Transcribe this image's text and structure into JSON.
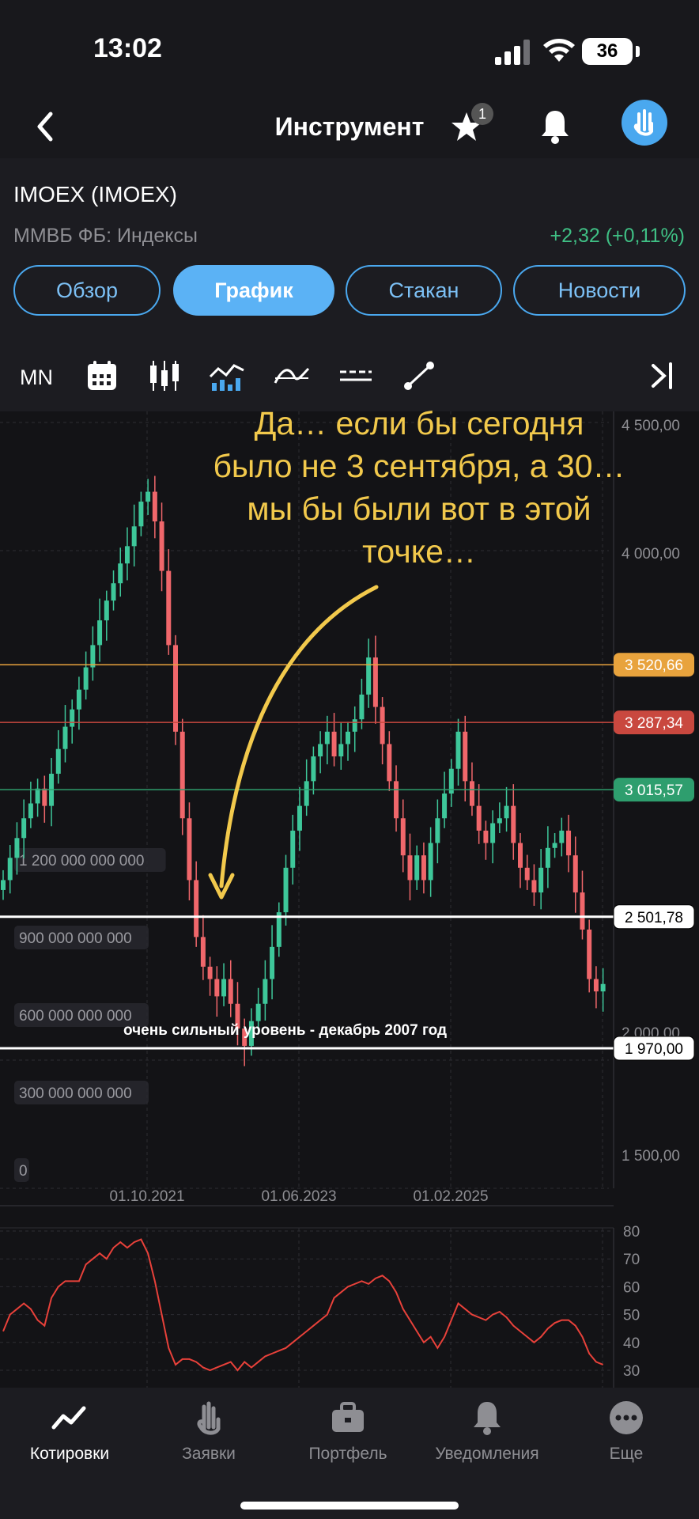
{
  "status": {
    "time": "13:02",
    "battery": "36"
  },
  "nav": {
    "title": "Инструмент",
    "favorites_count": "1"
  },
  "instrument": {
    "name": "IMOEX (IMOEX)",
    "market": "ММВБ ФБ: Индексы",
    "change": "+2,32 (+0,11%)"
  },
  "tabs": [
    {
      "label": "Обзор",
      "active": false
    },
    {
      "label": "График",
      "active": true
    },
    {
      "label": "Стакан",
      "active": false
    },
    {
      "label": "Новости",
      "active": false
    }
  ],
  "toolbar": {
    "interval": "MN"
  },
  "annotation": {
    "lines": [
      "Да… если бы сегодня",
      "было не 3 сентября, а 30…",
      "мы бы были вот в этой",
      "точке…"
    ],
    "level_note": "очень сильный уровень - декабрь 2007 год"
  },
  "colors": {
    "up": "#3ec79a",
    "down": "#f0676b",
    "accent": "#4aa8ef",
    "annotation": "#f2c94c",
    "level_orange": "#e8a33d",
    "level_red": "#c9483f",
    "level_green": "#2e9e6e"
  },
  "chart_data": [
    {
      "type": "candlestick",
      "title": "",
      "x_ticks": [
        "01.10.2021",
        "01.06.2023",
        "01.02.2025"
      ],
      "y_ticks": [
        "4 500,00",
        "4 000,00",
        "2 000,00",
        "1 500,00"
      ],
      "ylim": [
        1400,
        4550
      ],
      "volume_ticks": [
        "1 200 000 000 000",
        "900 000 000 000",
        "600 000 000 000",
        "300 000 000 000",
        "0"
      ],
      "levels": [
        {
          "value": 3520.66,
          "label": "3 520,66",
          "color": "#e8a33d"
        },
        {
          "value": 3287.34,
          "label": "3 287,34",
          "color": "#c9483f"
        },
        {
          "value": 3015.57,
          "label": "3 015,57",
          "color": "#2e9e6e"
        },
        {
          "value": 2501.78,
          "label": "2 501,78",
          "color": "#ffffff"
        },
        {
          "value": 1970.0,
          "label": "1 970,00",
          "color": "#ffffff"
        }
      ],
      "close": [
        2650,
        2740,
        2820,
        2900,
        2960,
        3020,
        2950,
        3080,
        3180,
        3270,
        3340,
        3420,
        3510,
        3600,
        3700,
        3780,
        3850,
        3930,
        4000,
        4080,
        4180,
        4220,
        4100,
        3900,
        3600,
        3250,
        2900,
        2650,
        2420,
        2300,
        2250,
        2180,
        2250,
        2150,
        2050,
        1980,
        2080,
        2150,
        2250,
        2380,
        2520,
        2700,
        2850,
        2950,
        3050,
        3150,
        3200,
        3250,
        3150,
        3200,
        3250,
        3300,
        3400,
        3550,
        3350,
        3200,
        3050,
        2900,
        2750,
        2650,
        2750,
        2650,
        2800,
        2900,
        3000,
        3100,
        3250,
        3050,
        2950,
        2850,
        2800,
        2880,
        2900,
        2950,
        2800,
        2700,
        2650,
        2600,
        2700,
        2780,
        2800,
        2850,
        2750,
        2600,
        2450,
        2250,
        2200,
        2230
      ],
      "first_x": "2020-01",
      "last_x": "2025-08"
    },
    {
      "type": "line",
      "title": "",
      "y_ticks": [
        "80",
        "70",
        "60",
        "50",
        "40",
        "30"
      ],
      "ylim": [
        27,
        80
      ],
      "values": [
        44,
        50,
        52,
        54,
        52,
        48,
        46,
        56,
        60,
        62,
        62,
        62,
        68,
        70,
        72,
        70,
        74,
        76,
        74,
        76,
        77,
        72,
        62,
        50,
        38,
        32,
        34,
        34,
        33,
        31,
        30,
        31,
        32,
        33,
        30,
        33,
        31,
        33,
        35,
        36,
        37,
        38,
        40,
        42,
        44,
        46,
        48,
        50,
        56,
        58,
        60,
        61,
        62,
        61,
        63,
        64,
        62,
        58,
        52,
        48,
        44,
        40,
        42,
        38,
        42,
        48,
        54,
        52,
        50,
        49,
        48,
        50,
        51,
        49,
        46,
        44,
        42,
        40,
        42,
        45,
        47,
        48,
        48,
        46,
        42,
        36,
        33,
        32
      ]
    }
  ]
}
